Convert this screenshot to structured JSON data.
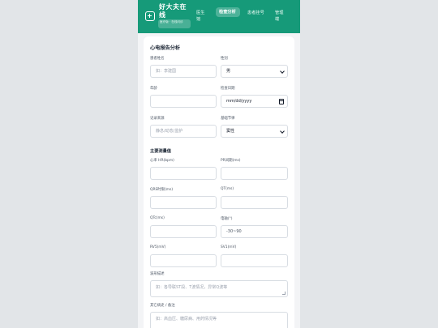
{
  "header": {
    "brand": "好大夫在线",
    "tag": "医疗版 · 在线问诊",
    "nav": [
      "医生馆",
      "检查分析",
      "患者挂号",
      "管理端"
    ],
    "active_nav": "检查分析"
  },
  "form": {
    "title": "心电报告分析",
    "patient_name": {
      "label": "患者姓名",
      "placeholder": "如：李建国"
    },
    "gender": {
      "label": "性别",
      "value": "男"
    },
    "age": {
      "label": "年龄",
      "value": ""
    },
    "check_date": {
      "label": "检查日期",
      "placeholder": "mm/dd/yyyy"
    },
    "record_source": {
      "label": "记录来源",
      "placeholder": "静息/动态/监护"
    },
    "base_rhythm": {
      "label": "基础节律",
      "value": "窦性"
    }
  },
  "measurements": {
    "title": "主要测量值",
    "heart_rate": {
      "label": "心率 HR(bpm)",
      "value": ""
    },
    "pr_interval": {
      "label": "PR间期(ms)",
      "value": ""
    },
    "qrs_duration": {
      "label": "QRS时限(ms)",
      "value": ""
    },
    "qt": {
      "label": "QT(ms)",
      "value": ""
    },
    "qtc": {
      "label": "QTc(ms)",
      "value": ""
    },
    "axis": {
      "label": "电轴(°)",
      "placeholder": "-30~90"
    },
    "rv5": {
      "label": "RV5(mV)",
      "value": ""
    },
    "sv1": {
      "label": "SV1(mV)",
      "value": ""
    },
    "waveform": {
      "label": "波形描述",
      "placeholder": "如：各导联ST段、T波情况，异常Q波等"
    },
    "history": {
      "label": "其它病史 / 备注",
      "placeholder": "如：高血压、糖尿病、用药情况等"
    }
  }
}
